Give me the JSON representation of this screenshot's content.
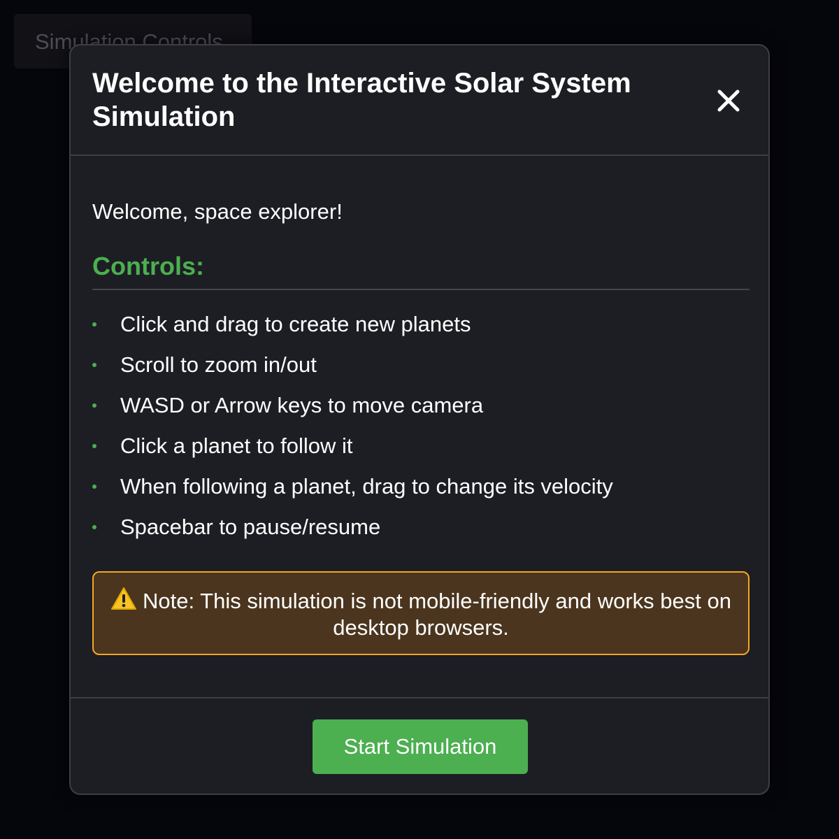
{
  "background": {
    "controls_button_label": "Simulation Controls"
  },
  "modal": {
    "title": "Welcome to the Interactive Solar System Simulation",
    "close_icon": "close-icon",
    "greeting": "Welcome, space explorer!",
    "controls_heading": "Controls:",
    "controls": [
      "Click and drag to create new planets",
      "Scroll to zoom in/out",
      "WASD or Arrow keys to move camera",
      "Click a planet to follow it",
      "When following a planet, drag to change its velocity",
      "Spacebar to pause/resume"
    ],
    "note": {
      "icon": "warning-icon",
      "text": "Note: This simulation is not mobile-friendly and works best on desktop browsers."
    },
    "start_button_label": "Start Simulation"
  },
  "colors": {
    "accent_green": "#4caf50",
    "warning_border": "#f5a623",
    "warning_background": "#4b351e",
    "modal_background": "#1d1e24",
    "page_background": "#05050c"
  }
}
